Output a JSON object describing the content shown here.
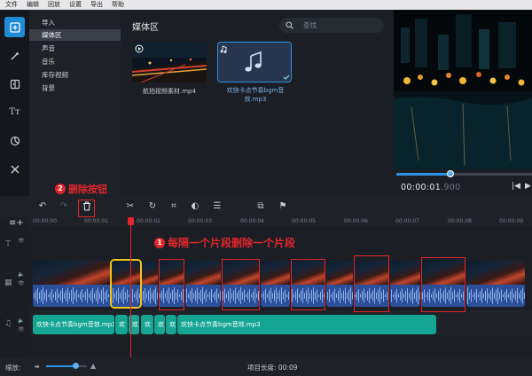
{
  "menu": [
    "文件",
    "编辑",
    "回放",
    "设置",
    "导出",
    "帮助"
  ],
  "categories": [
    "导入",
    "媒体区",
    "声音",
    "音乐",
    "库存视频",
    "背景"
  ],
  "media": {
    "title": "媒体区",
    "search_placeholder": "查找",
    "items": [
      {
        "label": "航拍视频素材.mp4"
      },
      {
        "label_line1": "欢快卡点节奏bgm音",
        "label_line2": "效.mp3"
      }
    ]
  },
  "preview": {
    "time_main": "00:00:01",
    "time_dim": ".900",
    "progress": 0.4
  },
  "ruler_ticks": [
    "00:00:00",
    "00:00:01",
    "00:00:02",
    "00:00:03",
    "00:00:04",
    "00:00:05",
    "00:00:06",
    "00:00:07",
    "00:00:08",
    "00:00:09"
  ],
  "audio_clips": [
    "欢快卡点节奏bgm音效.mp3",
    "欢",
    "欢",
    "欢",
    "欢",
    "欢",
    "欢快卡点节奏bgm音效.mp3"
  ],
  "annotations": {
    "delete_button": {
      "num": "2",
      "text": "删除按钮"
    },
    "alternate": {
      "num": "1",
      "text": "每隔一个片段删除一个片段"
    }
  },
  "status": {
    "zoom_label": "缩放:",
    "project_length": "项目长度: 00:09"
  },
  "colors": {
    "accent": "#1f8ad6",
    "annotation": "#e0262c",
    "audio_clip": "#14a593",
    "waveform": "#2c4f9a"
  }
}
